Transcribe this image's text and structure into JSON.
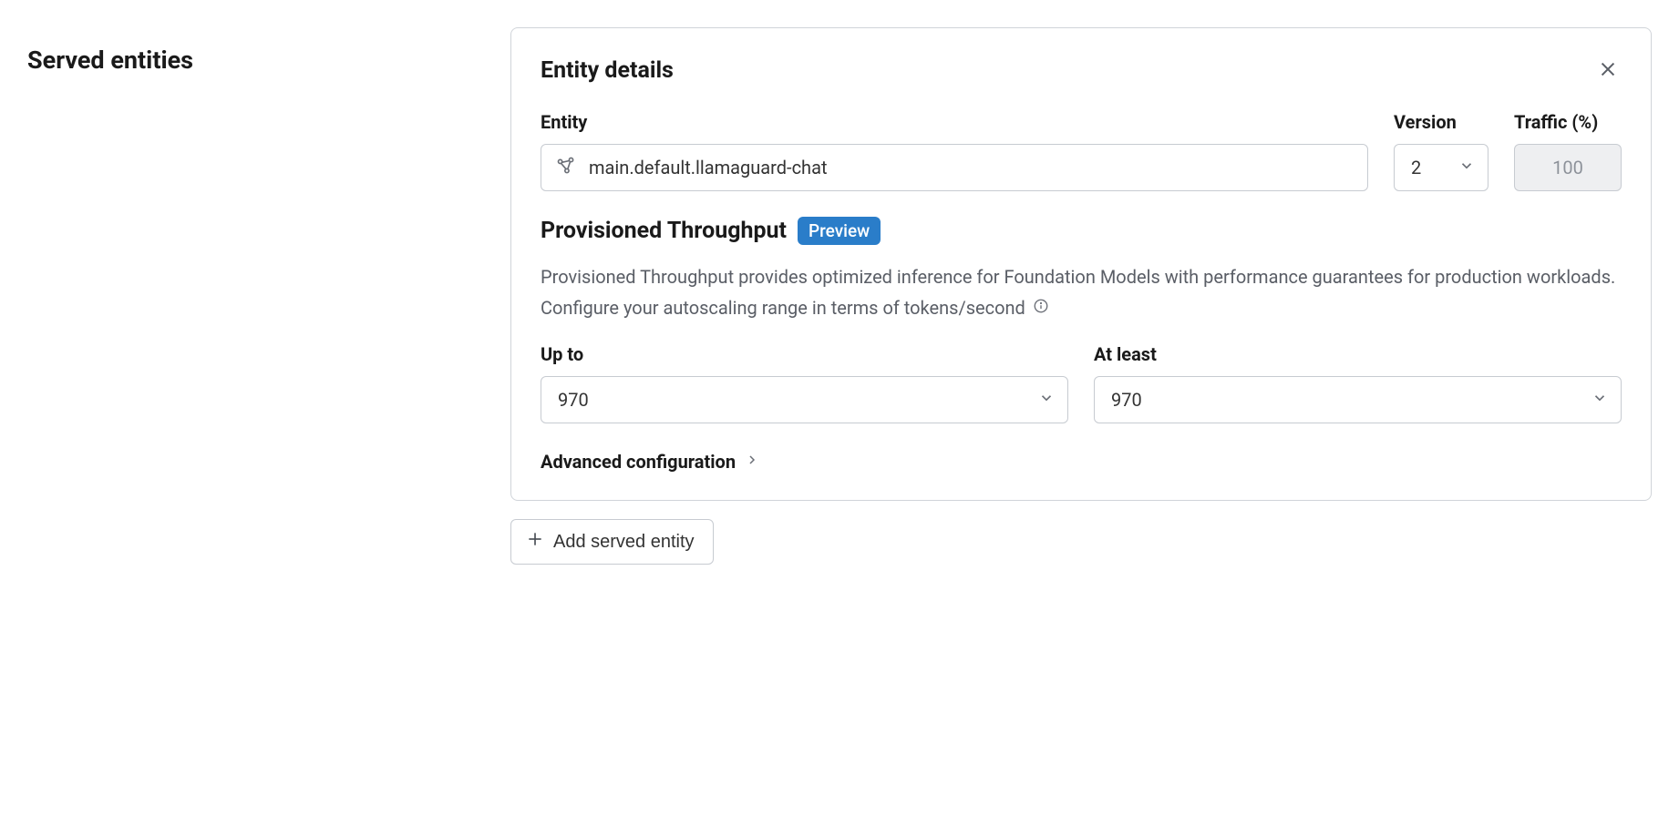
{
  "leftTitle": "Served entities",
  "card": {
    "title": "Entity details",
    "fields": {
      "entity": {
        "label": "Entity",
        "value": "main.default.llamaguard-chat"
      },
      "version": {
        "label": "Version",
        "value": "2"
      },
      "traffic": {
        "label": "Traffic (%)",
        "value": "100"
      }
    },
    "provisioned": {
      "heading": "Provisioned Throughput",
      "badge": "Preview",
      "description1": "Provisioned Throughput provides optimized inference for Foundation Models with performance guarantees for production workloads.",
      "description2": "Configure your autoscaling range in terms of tokens/second",
      "upTo": {
        "label": "Up to",
        "value": "970"
      },
      "atLeast": {
        "label": "At least",
        "value": "970"
      }
    },
    "advancedLabel": "Advanced configuration"
  },
  "addButton": "Add served entity"
}
